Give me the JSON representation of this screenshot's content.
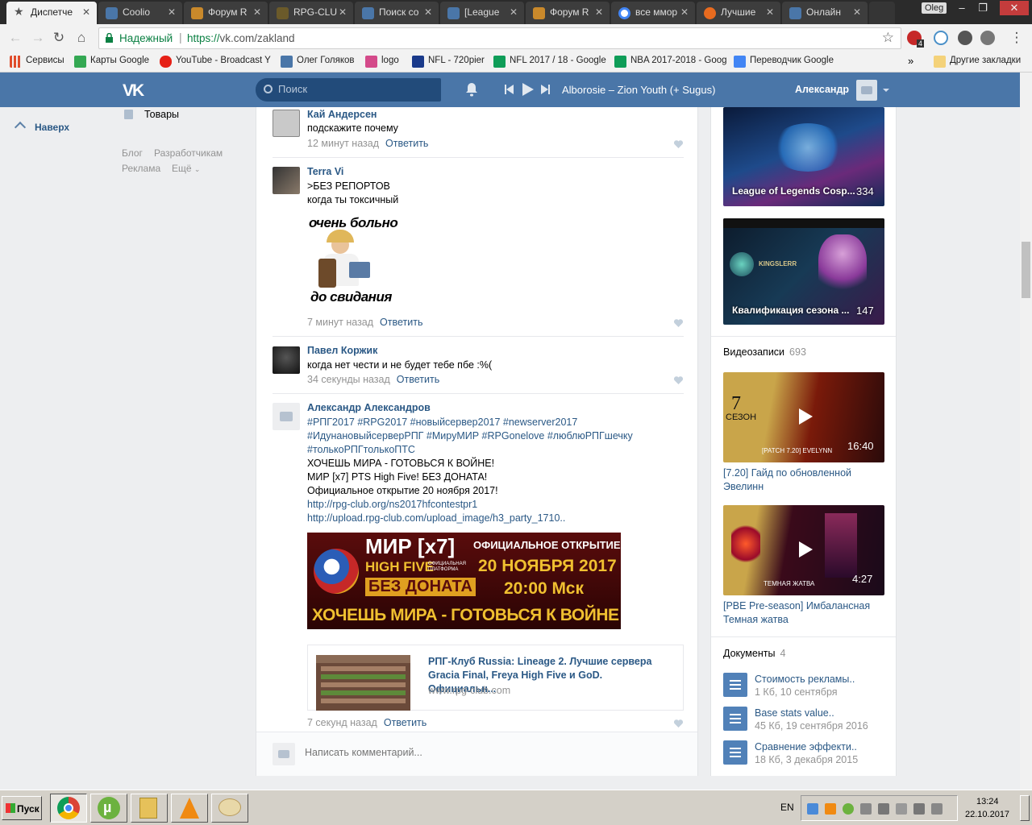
{
  "browser": {
    "tabs": [
      {
        "title": "Диспетче",
        "color": "#4a76a8"
      },
      {
        "title": "Coolio",
        "color": "#4a76a8"
      },
      {
        "title": "Форум R",
        "color": "#c9892b"
      },
      {
        "title": "RPG-CLU",
        "color": "#6b5a2a"
      },
      {
        "title": "Поиск со",
        "color": "#4a76a8"
      },
      {
        "title": "[League",
        "color": "#4a76a8"
      },
      {
        "title": "Форум R",
        "color": "#c9892b"
      },
      {
        "title": "все ммор",
        "color": "#4285f4"
      },
      {
        "title": "Лучшие",
        "color": "#e86b1f"
      },
      {
        "title": "Онлайн",
        "color": "#4a76a8"
      }
    ],
    "profile_name": "Oleg",
    "secure_label": "Надежный",
    "url_scheme": "https://",
    "url_rest": "vk.com/zakland",
    "ext_badge": "4",
    "bookmarks": [
      {
        "label": "Сервисы",
        "color": "#e04c2b"
      },
      {
        "label": "Карты Google",
        "color": "#34a853"
      },
      {
        "label": "YouTube - Broadcast Y",
        "color": "#e62117"
      },
      {
        "label": "Олег Голяков",
        "color": "#4a76a8"
      },
      {
        "label": "logo",
        "color": "#d44a8a"
      },
      {
        "label": "NFL - 720pier",
        "color": "#1a3a8a"
      },
      {
        "label": "NFL 2017 / 18 - Google",
        "color": "#0f9d58"
      },
      {
        "label": "NBA 2017-2018 - Goog",
        "color": "#0f9d58"
      },
      {
        "label": "Переводчик Google",
        "color": "#4285f4"
      }
    ],
    "bookmarks_more": "»",
    "other_bookmarks": "Другие закладки"
  },
  "vk_header": {
    "logo": "VK",
    "search_placeholder": "Поиск",
    "track": "Alborosie – Zion Youth (+ Sugus)",
    "username": "Александр"
  },
  "sidebar": {
    "to_top": "Наверх",
    "goods": "Товары",
    "links": [
      "Блог",
      "Разработчикам",
      "Реклама",
      "Ещё"
    ]
  },
  "comments": [
    {
      "name": "Кай Андерсен",
      "lines": [
        "подскажите почему"
      ],
      "time": "12 минут назад",
      "reply": "Ответить"
    },
    {
      "name": "Terra Vi",
      "lines": [
        ">БЕЗ РЕПОРТОВ",
        "когда ты токсичный"
      ],
      "meme_top": "очень больно",
      "meme_bottom": "до свидания",
      "time": "7 минут назад",
      "reply": "Ответить"
    },
    {
      "name": "Павел Коржик",
      "lines": [
        "когда нет чести и не будет тебе пбе :%("
      ],
      "time": "34 секунды назад",
      "reply": "Ответить"
    },
    {
      "name": "Александр Александров",
      "tags": [
        "#РПГ2017 #RPG2017 #новыйсервер2017 #newserver2017",
        "#ИдунановыйсерверРПГ #МируМИР #RPGonelove #люблюРПГшечку",
        "#толькоРПГтолькоПТС"
      ],
      "lines": [
        "ХОЧЕШЬ МИРА - ГОТОВЬСЯ К ВОЙНЕ!",
        "МИР [x7] PTS High Five! БЕЗ ДОНАТА!",
        "Официальное открытие 20 ноября 2017!"
      ],
      "links": [
        "http://rpg-club.org/ns2017hfcontestpr1",
        "http://upload.rpg-club.com/upload_image/h3_party_1710.."
      ],
      "banner": {
        "mir": "МИР [x7]",
        "high_five": "HIGH FIVE",
        "platform": "ОФИЦИАЛЬНАЯ ПЛАТФОРМА",
        "no_donate": "БЕЗ ДОНАТА",
        "opening": "ОФИЦИАЛЬНОЕ ОТКРЫТИЕ",
        "date": "20 НОЯБРЯ 2017",
        "time": "20:00 Мск",
        "slogan": "ХОЧЕШЬ МИРА - ГОТОВЬСЯ К ВОЙНЕ"
      },
      "snippet": {
        "title": "РПГ-Клуб Russia: Lineage 2. Лучшие сервера Gracia Final, Freya High Five и GoD. Официальн...",
        "domain": "www.rpg-club.com"
      },
      "time": "7 секунд назад",
      "reply": "Ответить"
    }
  ],
  "comment_box": {
    "placeholder": "Написать комментарий..."
  },
  "right": {
    "albums": [
      {
        "label": "League of Legends Cosp...",
        "count": "334"
      },
      {
        "label": "Квалификация сезона ...",
        "count": "147",
        "inner": "KINGSLERR"
      }
    ],
    "videos_header": "Видеозаписи",
    "videos_count": "693",
    "videos": [
      {
        "title": "[7.20] Гайд по обновленной Эвелинн",
        "duration": "16:40",
        "season_num": "7",
        "season_word": "СЕЗОН",
        "caption": "[PATCH 7.20] EVELYNN"
      },
      {
        "title": "[PBE Pre-season] Имбалансная Темная жатва",
        "duration": "4:27",
        "caption": "ТЕМНАЯ ЖАТВА"
      }
    ],
    "docs_header": "Документы",
    "docs_count": "4",
    "docs": [
      {
        "name": "Стоимость рекламы..",
        "meta": "1 Кб, 10 сентября"
      },
      {
        "name": "Base stats value..",
        "meta": "45 Кб, 19 сентября 2016"
      },
      {
        "name": "Сравнение эффекти..",
        "meta": "18 Кб, 3 декабря 2015"
      }
    ]
  },
  "taskbar": {
    "start": "Пуск",
    "lang": "EN",
    "time": "13:24",
    "date": "22.10.2017"
  }
}
